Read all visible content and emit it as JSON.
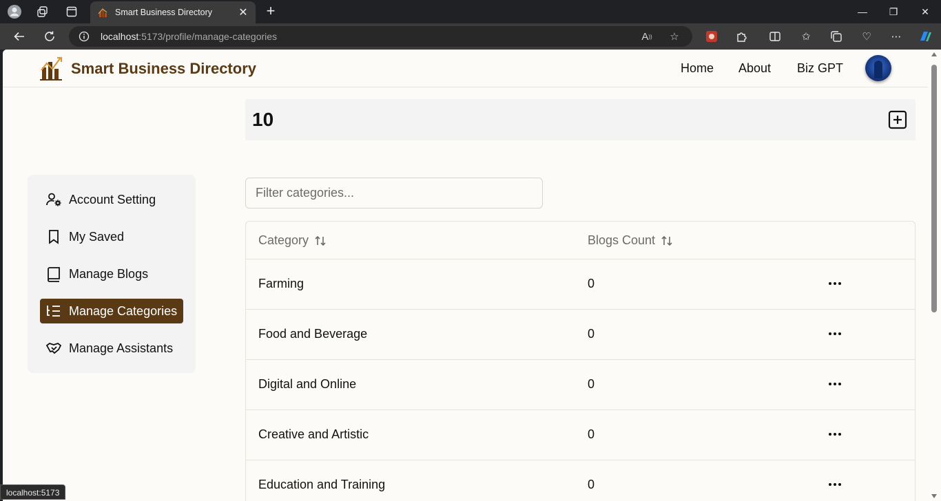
{
  "browser": {
    "tab_title": "Smart Business Directory",
    "url_host": "localhost",
    "url_rest": ":5173/profile/manage-categories",
    "status_text": "localhost:5173"
  },
  "header": {
    "brand": "Smart Business Directory",
    "nav": [
      "Home",
      "About",
      "Biz GPT"
    ]
  },
  "count_bar": {
    "count": "10"
  },
  "sidebar": {
    "items": [
      {
        "label": "Account Setting",
        "icon": "user-gear-icon",
        "active": false
      },
      {
        "label": "My Saved",
        "icon": "bookmark-icon",
        "active": false
      },
      {
        "label": "Manage Blogs",
        "icon": "book-icon",
        "active": false
      },
      {
        "label": "Manage Categories",
        "icon": "list-tree-icon",
        "active": true
      },
      {
        "label": "Manage Assistants",
        "icon": "handshake-icon",
        "active": false
      }
    ]
  },
  "filter": {
    "placeholder": "Filter categories..."
  },
  "table": {
    "headers": [
      "Category",
      "Blogs Count"
    ],
    "rows": [
      {
        "category": "Farming",
        "blogs": "0"
      },
      {
        "category": "Food and Beverage",
        "blogs": "0"
      },
      {
        "category": "Digital and Online",
        "blogs": "0"
      },
      {
        "category": "Creative and Artistic",
        "blogs": "0"
      },
      {
        "category": "Education and Training",
        "blogs": "0"
      }
    ]
  },
  "colors": {
    "brand": "#5a3a14",
    "page_bg": "#fdfbf7",
    "panel_bg": "#f2f3f2"
  }
}
